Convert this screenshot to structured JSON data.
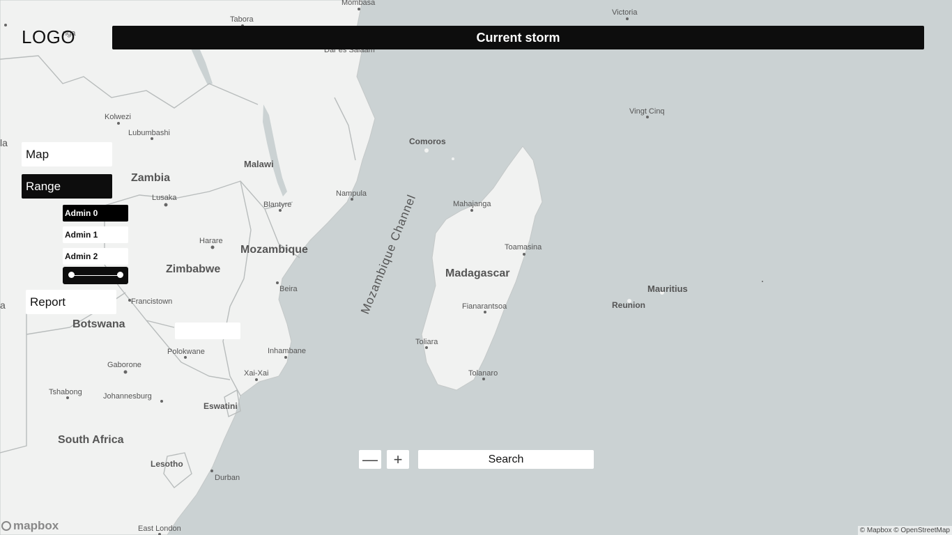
{
  "header": {
    "logo": "LOGO",
    "title": "Current storm"
  },
  "sidebar": {
    "map_label": "Map",
    "range_label": "Range",
    "admin_levels": [
      "Admin 0",
      "Admin 1",
      "Admin 2"
    ],
    "report_label": "Report"
  },
  "range_slider": {
    "min": 0,
    "max": 1,
    "low": 0,
    "high": 1
  },
  "bottom": {
    "zoom_out": "—",
    "zoom_in": "+",
    "search_label": "Search"
  },
  "footer": {
    "mapbox": "mapbox",
    "attribution": "© Mapbox © OpenStreetMap"
  },
  "map": {
    "colors": {
      "water": "#cbd2d3",
      "land": "#f1f2f1",
      "border": "#b8bcbc"
    },
    "labels": {
      "mombasa": "Mombasa",
      "tabora": "Tabora",
      "victoria": "Victoria",
      "dar": "Dar es Salaam",
      "kolwezi": "Kolwezi",
      "lubumbashi": "Lubumbashi",
      "vingt_cinq": "Vingt Cinq",
      "comoros": "Comoros",
      "zambia": "Zambia",
      "malawi": "Malawi",
      "lusaka": "Lusaka",
      "nampula": "Nampula",
      "blantyre": "Blantyre",
      "mahajanga": "Mahajanga",
      "mozambique_channel": "Mozambique Channel",
      "harare": "Harare",
      "mozambique": "Mozambique",
      "toamasina": "Toamasina",
      "zimbabwe": "Zimbabwe",
      "madagascar": "Madagascar",
      "beira": "Beira",
      "mauritius": "Mauritius",
      "francistown": "Francistown",
      "reunion": "Reunion",
      "fianarantsoa": "Fianarantsoa",
      "botswana": "Botswana",
      "toliara": "Toliara",
      "polokwane": "Polokwane",
      "inhambane": "Inhambane",
      "tolanaro": "Tolanaro",
      "gaborone": "Gaborone",
      "xai_xai": "Xai-Xai",
      "tshabong": "Tshabong",
      "johannesburg": "Johannesburg",
      "eswatini": "Eswatini",
      "south_africa": "South Africa",
      "lesotho": "Lesotho",
      "durban": "Durban",
      "east_london": "East London",
      "nga": "nga",
      "la": "la",
      "a": "a"
    }
  }
}
